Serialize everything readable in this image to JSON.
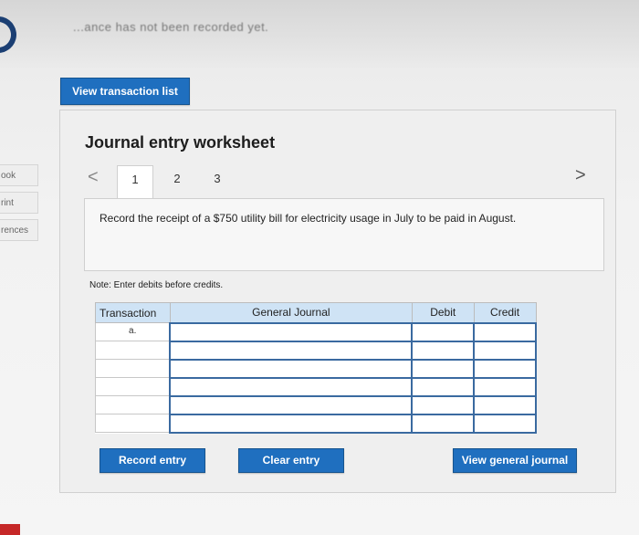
{
  "header": {
    "cut_text": "...ance has not been recorded yet."
  },
  "left_nav": {
    "items": [
      "ook",
      "rint",
      "rences"
    ]
  },
  "buttons": {
    "view_transaction_list": "View transaction list",
    "record_entry": "Record entry",
    "clear_entry": "Clear entry",
    "view_general_journal": "View general journal"
  },
  "worksheet": {
    "title": "Journal entry worksheet",
    "pages": [
      "1",
      "2",
      "3"
    ],
    "active_page": "1",
    "prev_arrow": "<",
    "next_arrow": ">",
    "description": "Record the receipt of a $750 utility bill for electricity usage in July to be paid in August.",
    "note": "Note: Enter debits before credits."
  },
  "table": {
    "headers": {
      "transaction": "Transaction",
      "general_journal": "General Journal",
      "debit": "Debit",
      "credit": "Credit"
    },
    "rows": [
      {
        "transaction": "a."
      },
      {
        "transaction": ""
      },
      {
        "transaction": ""
      },
      {
        "transaction": ""
      },
      {
        "transaction": ""
      },
      {
        "transaction": ""
      }
    ]
  },
  "colors": {
    "button_blue": "#1f6fbf",
    "header_blue": "#cfe3f5",
    "input_border": "#3a6aa0"
  }
}
